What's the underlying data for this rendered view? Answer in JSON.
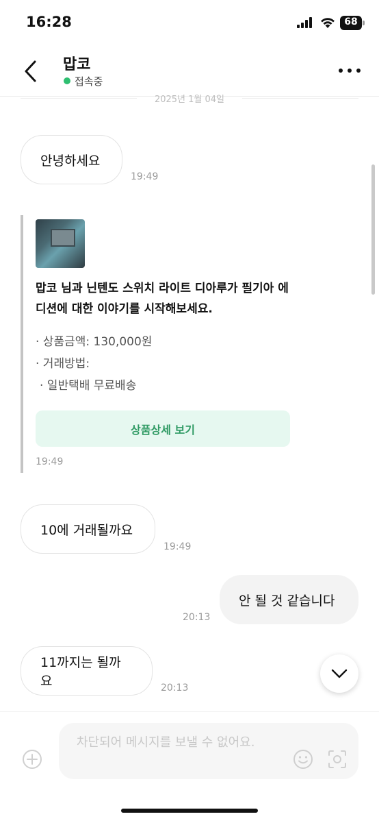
{
  "status_bar": {
    "time": "16:28",
    "battery": "68"
  },
  "header": {
    "title": "맙코",
    "presence": "접속중"
  },
  "date_divider": "2025년 1월 04일",
  "messages": [
    {
      "text": "안녕하세요",
      "time": "19:49"
    },
    {
      "text": "10에 거래될까요",
      "time": "19:49"
    },
    {
      "text": "안 될 것 같습니다",
      "time": "20:13"
    },
    {
      "text": "11까지는 될까요",
      "time": "20:13"
    }
  ],
  "product_card": {
    "title": "맙코 님과 닌텐도 스위치 라이트 디아루가 필기아 에디션에 대한 이야기를 시작해보세요.",
    "price": "· 상품금액: 130,000원",
    "method_label": "· 거래방법:",
    "method_value": "· 일반택배 무료배송",
    "button": "상품상세 보기",
    "time": "19:49"
  },
  "input": {
    "placeholder": "차단되어 메시지를 보낼 수 없어요."
  },
  "colors": {
    "online": "#2fbf71",
    "accent_green": "#2e9a63",
    "button_bg": "#e6f8f0"
  }
}
